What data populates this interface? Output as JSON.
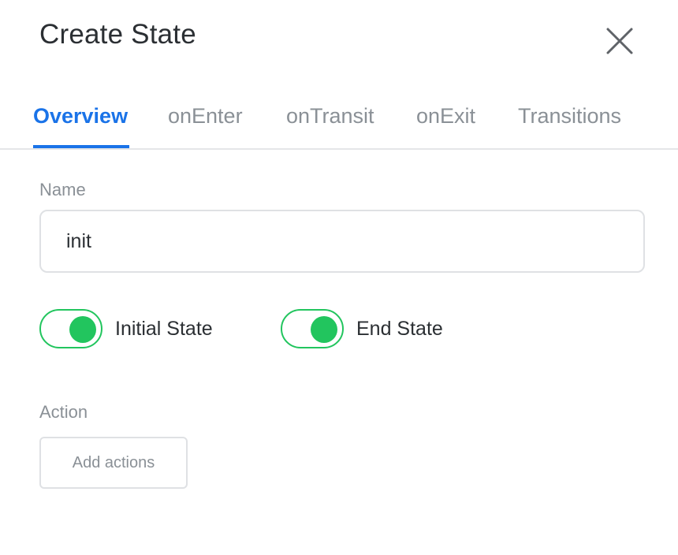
{
  "dialog": {
    "title": "Create State"
  },
  "close_icon": "close-icon",
  "tabs": [
    {
      "label": "Overview",
      "active": true
    },
    {
      "label": "onEnter",
      "active": false
    },
    {
      "label": "onTransit",
      "active": false
    },
    {
      "label": "onExit",
      "active": false
    },
    {
      "label": "Transitions",
      "active": false
    }
  ],
  "name_field": {
    "label": "Name",
    "value": "init"
  },
  "toggles": {
    "initial_state": {
      "label": "Initial State",
      "on": true
    },
    "end_state": {
      "label": "End State",
      "on": true
    }
  },
  "action": {
    "label": "Action",
    "button_label": "Add actions"
  },
  "colors": {
    "accent": "#1a73e8",
    "toggle_on": "#22c55e",
    "muted_text": "#8a9096",
    "text": "#2b2f33"
  }
}
